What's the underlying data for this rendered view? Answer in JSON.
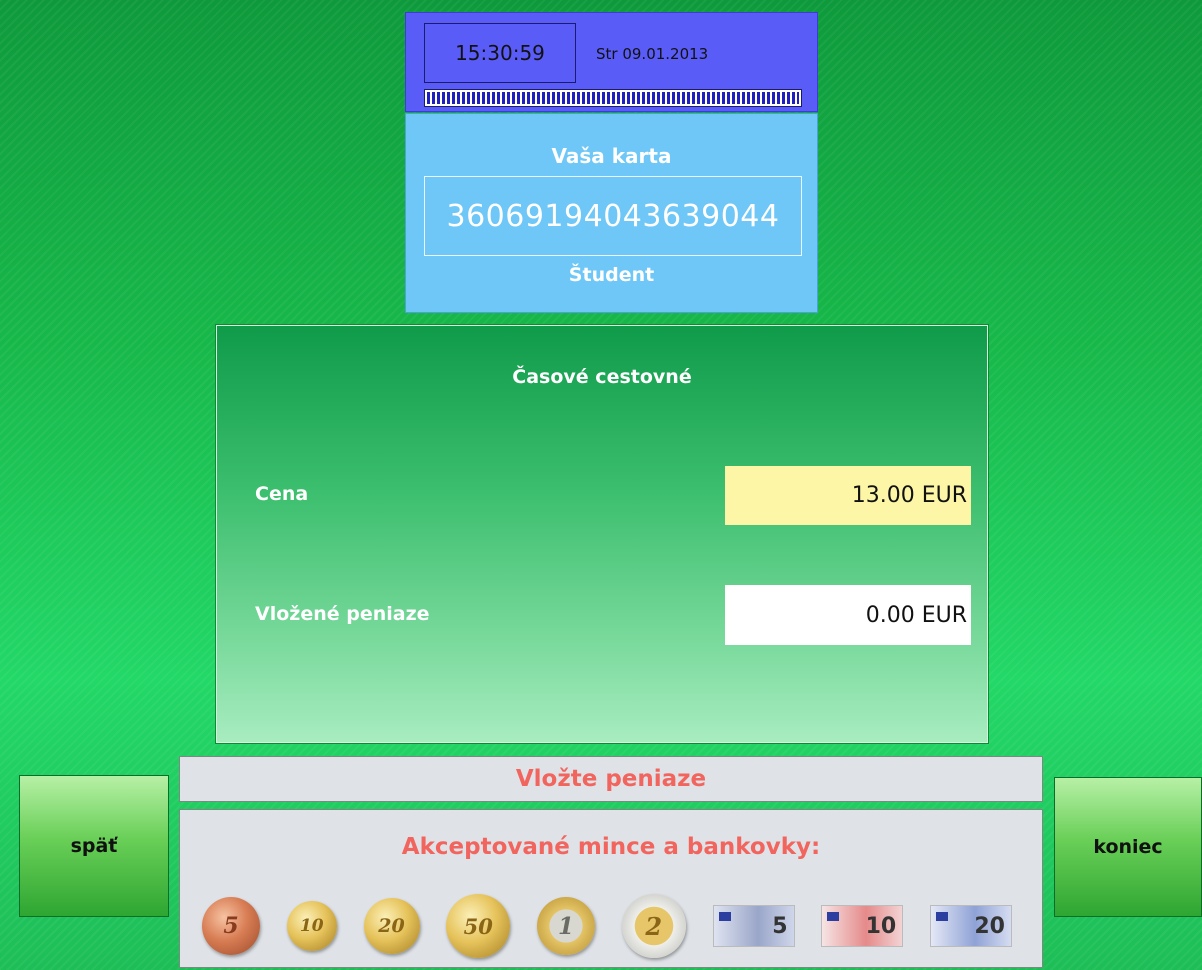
{
  "header": {
    "time": "15:30:59",
    "date": "Str 09.01.2013",
    "progress": 1.0
  },
  "card": {
    "title": "Vaša karta",
    "number": "3606919404363904​4",
    "type": "Študent"
  },
  "fare": {
    "title": "Časové cestovné",
    "price_label": "Cena",
    "price_value": "13.00 EUR",
    "inserted_label": "Vložené peniaze",
    "inserted_value": "0.00 EUR"
  },
  "instruction": "Vložte peniaze",
  "accepted": {
    "title": "Akceptované mince a bankovky:",
    "coins": [
      {
        "label": "5",
        "icon": "coin-5-cent-icon"
      },
      {
        "label": "10",
        "icon": "coin-10-cent-icon"
      },
      {
        "label": "20",
        "icon": "coin-20-cent-icon"
      },
      {
        "label": "50",
        "icon": "coin-50-cent-icon"
      },
      {
        "label": "1",
        "icon": "coin-1-euro-icon"
      },
      {
        "label": "2",
        "icon": "coin-2-euro-icon"
      }
    ],
    "notes": [
      {
        "label": "5",
        "icon": "banknote-5-euro-icon"
      },
      {
        "label": "10",
        "icon": "banknote-10-euro-icon"
      },
      {
        "label": "20",
        "icon": "banknote-20-euro-icon"
      }
    ]
  },
  "buttons": {
    "back": "späť",
    "end": "koniec"
  },
  "colors": {
    "clock_panel": "#5a5cf7",
    "card_panel": "#6ec7f7",
    "price_field": "#fdf6a6",
    "message_text": "#f2655e"
  }
}
